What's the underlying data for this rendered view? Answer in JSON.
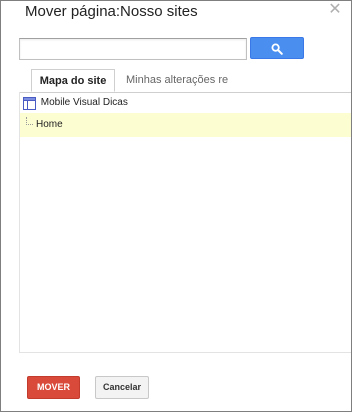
{
  "dialog": {
    "title": "Mover página:Nosso sites",
    "close_symbol": "✕"
  },
  "search": {
    "value": "",
    "placeholder": "",
    "button_icon": "search-icon"
  },
  "tabs": [
    {
      "label": "Mapa do site",
      "active": true
    },
    {
      "label": "Minhas alterações re",
      "active": false
    }
  ],
  "tree": {
    "root": {
      "label": "Mobile Visual Dicas",
      "icon": "site-icon"
    },
    "children": [
      {
        "label": "Home",
        "highlighted": true
      }
    ]
  },
  "actions": {
    "move_label": "MOVER",
    "cancel_label": "Cancelar"
  },
  "colors": {
    "primary_button": "#d94a3a",
    "search_button": "#4a8ef0",
    "highlight_row": "#fdfdd2"
  }
}
